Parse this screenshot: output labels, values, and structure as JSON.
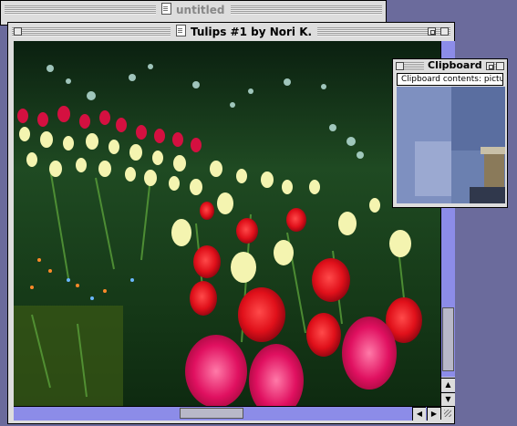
{
  "windows": {
    "untitled": {
      "title": "untitled"
    },
    "painting": {
      "title": "Tulips #1 by Nori K."
    },
    "clipboard": {
      "title": "Clipboard",
      "contents_label": "Clipboard contents: picture"
    }
  },
  "icons": {
    "document": "document-icon",
    "close": "close-box-icon",
    "zoom": "zoom-box-icon",
    "collapse": "collapse-box-icon",
    "up": "scroll-up-arrow-icon",
    "down": "scroll-down-arrow-icon",
    "left": "scroll-left-arrow-icon",
    "right": "scroll-right-arrow-icon",
    "grow": "grow-box-icon"
  },
  "colors": {
    "desktop": "#6b6b9c",
    "scroll_track": "#8c8ce8",
    "title_bar": "#dddddd"
  },
  "scroll": {
    "vertical_position": 0.9,
    "horizontal_position": 0.5
  }
}
